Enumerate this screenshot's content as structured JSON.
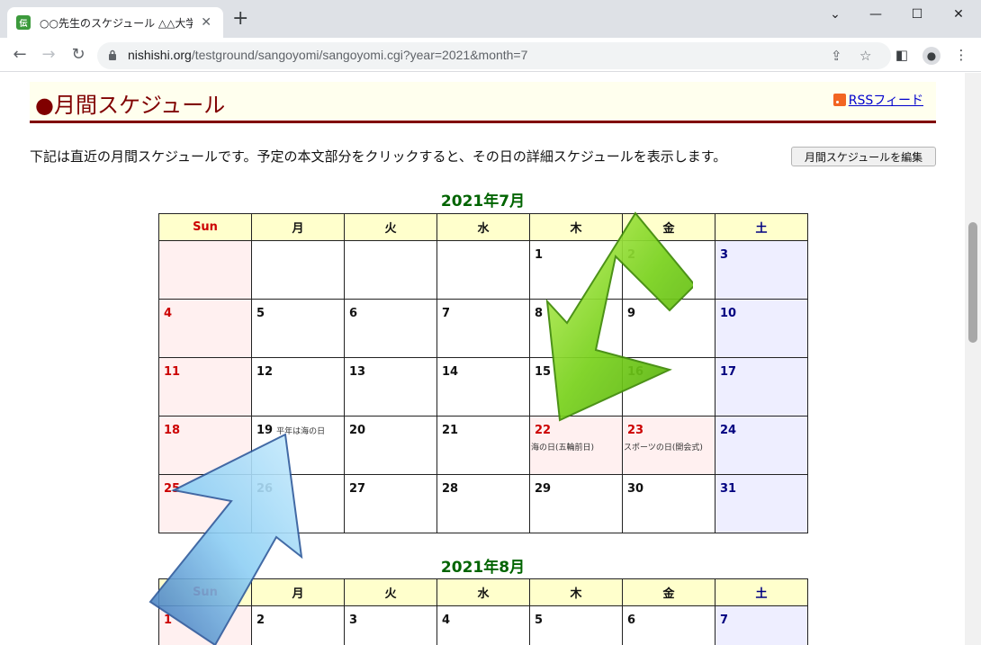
{
  "browser": {
    "tab_title": "○○先生のスケジュール △△大学☆",
    "favicon_text": "伝",
    "url_host": "nishishi.org",
    "url_path": "/testground/sangoyomi/sangoyomi.cgi?year=2021&month=7"
  },
  "page": {
    "section_title": "●月間スケジュール",
    "rss_label": "RSSフィード",
    "intro_text": "下記は直近の月間スケジュールです。予定の本文部分をクリックすると、その日の詳細スケジュールを表示します。",
    "edit_button": "月間スケジュールを編集"
  },
  "calendars": [
    {
      "title": "2021年7月",
      "weekdays": [
        "Sun",
        "月",
        "火",
        "水",
        "木",
        "金",
        "土"
      ],
      "weeks": [
        [
          {
            "day": ""
          },
          {
            "day": ""
          },
          {
            "day": ""
          },
          {
            "day": ""
          },
          {
            "day": "1"
          },
          {
            "day": "2"
          },
          {
            "day": "3"
          }
        ],
        [
          {
            "day": "4"
          },
          {
            "day": "5"
          },
          {
            "day": "6"
          },
          {
            "day": "7"
          },
          {
            "day": "8"
          },
          {
            "day": "9"
          },
          {
            "day": "10"
          }
        ],
        [
          {
            "day": "11"
          },
          {
            "day": "12"
          },
          {
            "day": "13"
          },
          {
            "day": "14"
          },
          {
            "day": "15"
          },
          {
            "day": "16"
          },
          {
            "day": "17"
          }
        ],
        [
          {
            "day": "18"
          },
          {
            "day": "19",
            "note": "平年は海の日"
          },
          {
            "day": "20"
          },
          {
            "day": "21"
          },
          {
            "day": "22",
            "holiday": true,
            "note": "海の日(五輪前日)"
          },
          {
            "day": "23",
            "holiday": true,
            "note": "スポーツの日(開会式)"
          },
          {
            "day": "24"
          }
        ],
        [
          {
            "day": "25"
          },
          {
            "day": "26"
          },
          {
            "day": "27"
          },
          {
            "day": "28"
          },
          {
            "day": "29"
          },
          {
            "day": "30"
          },
          {
            "day": "31"
          }
        ]
      ]
    },
    {
      "title": "2021年8月",
      "weekdays": [
        "Sun",
        "月",
        "火",
        "水",
        "木",
        "金",
        "土"
      ],
      "weeks": [
        [
          {
            "day": "1"
          },
          {
            "day": "2"
          },
          {
            "day": "3"
          },
          {
            "day": "4"
          },
          {
            "day": "5"
          },
          {
            "day": "6"
          },
          {
            "day": "7"
          }
        ]
      ]
    }
  ],
  "colors": {
    "accent_maroon": "#800000",
    "month_green": "#006400",
    "header_yellow": "#ffffcc",
    "arrow_green": "#66cc00",
    "arrow_blue": "#66bbee"
  }
}
